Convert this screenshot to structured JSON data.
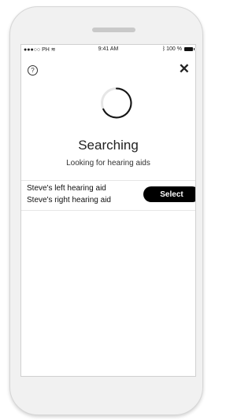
{
  "statusbar": {
    "carrier": "●●●○○ PH",
    "wifi_icon": "wifi-icon",
    "time": "9:41 AM",
    "bluetooth_icon": "bluetooth-icon",
    "battery": "100 %"
  },
  "header": {
    "help_glyph": "?",
    "close_glyph": "✕"
  },
  "search": {
    "title": "Searching",
    "subtitle": "Looking for hearing aids"
  },
  "devices": {
    "left": "Steve's left hearing aid",
    "right": "Steve's right hearing aid",
    "select_label": "Select"
  },
  "colors": {
    "button": "#000000",
    "button_text": "#ffffff"
  }
}
